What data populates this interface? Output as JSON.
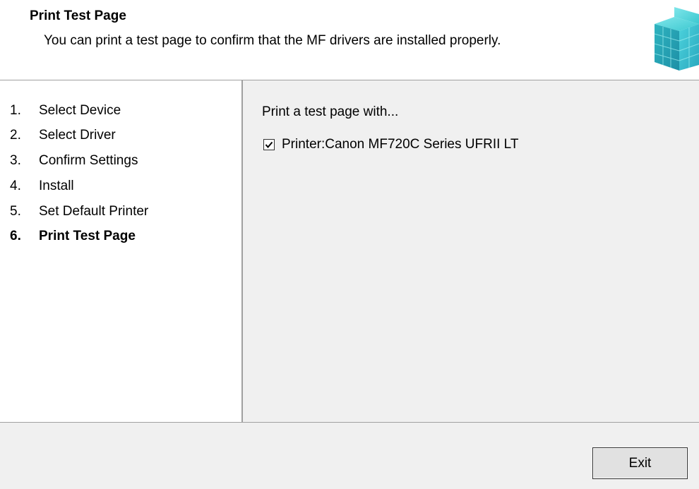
{
  "header": {
    "title": "Print Test Page",
    "description": "You can print a test page to confirm that the MF drivers are installed properly.",
    "logo_icon": "canon-mf-cube-icon"
  },
  "steps": [
    {
      "number": "1.",
      "label": "Select Device",
      "active": false
    },
    {
      "number": "2.",
      "label": "Select Driver",
      "active": false
    },
    {
      "number": "3.",
      "label": "Confirm Settings",
      "active": false
    },
    {
      "number": "4.",
      "label": "Install",
      "active": false
    },
    {
      "number": "5.",
      "label": "Set Default Printer",
      "active": false
    },
    {
      "number": "6.",
      "label": "Print Test Page",
      "active": true
    }
  ],
  "content": {
    "title": "Print a test page with...",
    "printer_option": {
      "label": "Printer:Canon MF720C Series UFRII LT",
      "checked": true
    }
  },
  "footer": {
    "exit_label": "Exit"
  },
  "colors": {
    "pane_background": "#f0f0f0",
    "header_background": "#ffffff",
    "divider": "#a0a0a0",
    "logo_teal": "#3cc8d0"
  }
}
